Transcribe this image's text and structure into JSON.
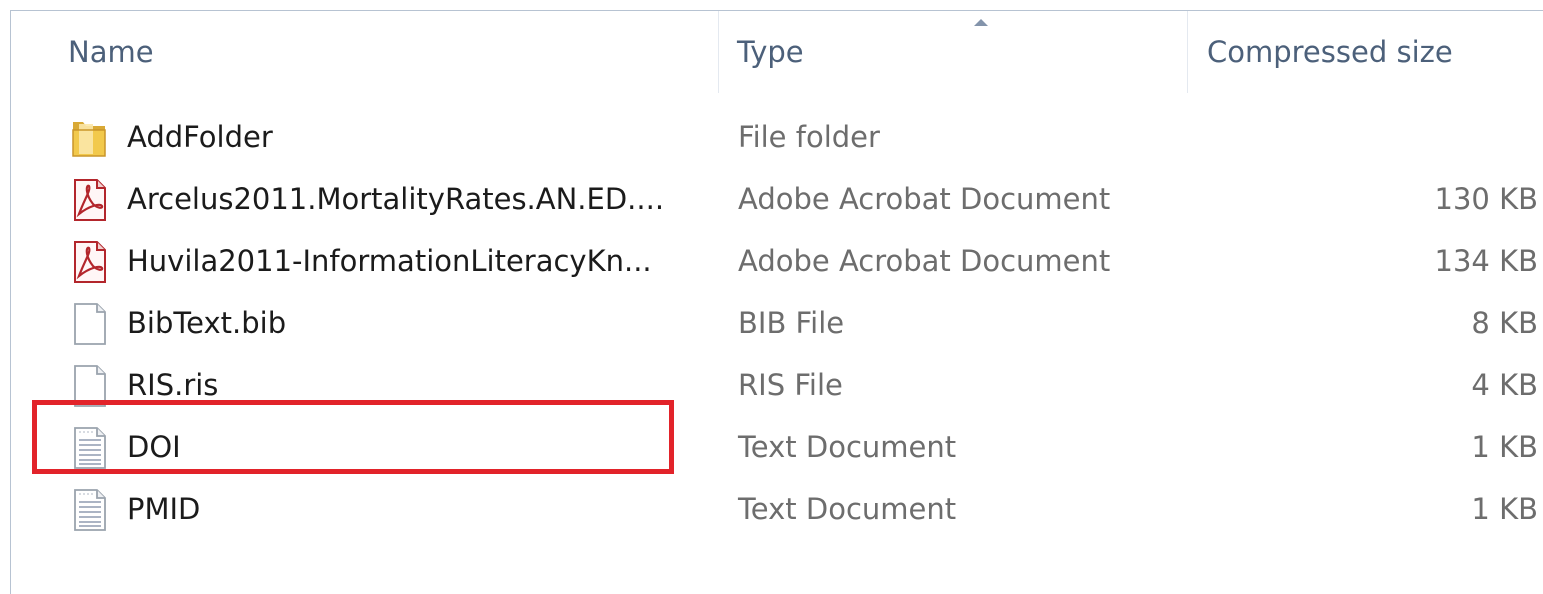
{
  "columns": {
    "name": "Name",
    "type": "Type",
    "compressed_size": "Compressed size"
  },
  "files": [
    {
      "name": "AddFolder",
      "type": "File folder",
      "size": "",
      "icon": "folder-icon"
    },
    {
      "name": "Arcelus2011.MortalityRates.AN.ED....",
      "type": "Adobe Acrobat Document",
      "size": "130 KB",
      "icon": "pdf-icon"
    },
    {
      "name": "Huvila2011-InformationLiteracyKn...",
      "type": "Adobe Acrobat Document",
      "size": "134 KB",
      "icon": "pdf-icon"
    },
    {
      "name": "BibText.bib",
      "type": "BIB File",
      "size": "8 KB",
      "icon": "file-icon"
    },
    {
      "name": "RIS.ris",
      "type": "RIS File",
      "size": "4 KB",
      "icon": "file-icon"
    },
    {
      "name": "DOI",
      "type": "Text Document",
      "size": "1 KB",
      "icon": "text-document-icon"
    },
    {
      "name": "PMID",
      "type": "Text Document",
      "size": "1 KB",
      "icon": "text-document-icon"
    }
  ],
  "colors": {
    "header_text": "#4c607a",
    "highlight": "#e2232a",
    "pdf_red": "#b3262c",
    "folder_yellow": "#f2c94c"
  }
}
